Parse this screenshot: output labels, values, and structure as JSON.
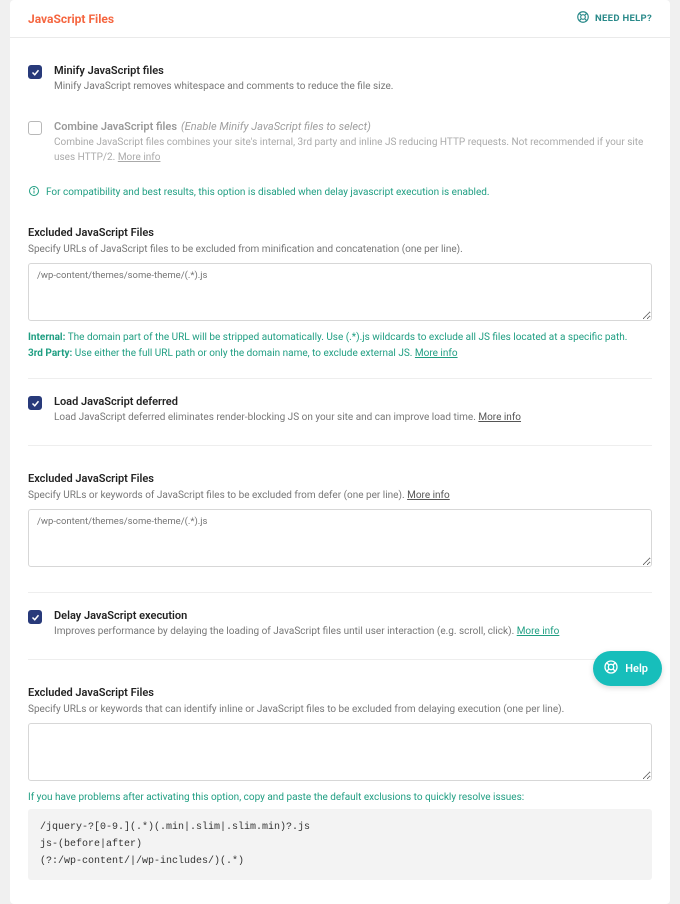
{
  "header": {
    "title": "JavaScript Files",
    "needHelp": "NEED HELP?"
  },
  "minify": {
    "label": "Minify JavaScript files",
    "desc": "Minify JavaScript removes whitespace and comments to reduce the file size.",
    "checked": true
  },
  "combine": {
    "label": "Combine JavaScript files",
    "suffix": "(Enable Minify JavaScript files to select)",
    "desc": "Combine JavaScript files combines your site's internal, 3rd party and inline JS reducing HTTP requests. Not recommended if your site uses HTTP/2.",
    "moreInfo": "More info",
    "note": "For compatibility and best results, this option is disabled when delay javascript execution is enabled.",
    "checked": false
  },
  "excludeMinify": {
    "label": "Excluded JavaScript Files",
    "desc": "Specify URLs of JavaScript files to be excluded from minification and concatenation (one per line).",
    "placeholder": "/wp-content/themes/some-theme/(.*).js",
    "value": "",
    "hintInternalLabel": "Internal:",
    "hintInternal": "The domain part of the URL will be stripped automatically. Use (.*).js wildcards to exclude all JS files located at a specific path.",
    "hint3rdLabel": "3rd Party:",
    "hint3rd": "Use either the full URL path or only the domain name, to exclude external JS.",
    "moreInfo": "More info"
  },
  "defer": {
    "label": "Load JavaScript deferred",
    "desc": "Load JavaScript deferred eliminates render-blocking JS on your site and can improve load time.",
    "moreInfo": "More info",
    "checked": true
  },
  "excludeDefer": {
    "label": "Excluded JavaScript Files",
    "desc": "Specify URLs or keywords of JavaScript files to be excluded from defer (one per line).",
    "moreInfo": "More info",
    "placeholder": "/wp-content/themes/some-theme/(.*).js",
    "value": ""
  },
  "delay": {
    "label": "Delay JavaScript execution",
    "desc": "Improves performance by delaying the loading of JavaScript files until user interaction (e.g. scroll, click).",
    "moreInfo": "More info",
    "checked": true
  },
  "excludeDelay": {
    "label": "Excluded JavaScript Files",
    "desc": "Specify URLs or keywords that can identify inline or JavaScript files to be excluded from delaying execution (one per line).",
    "value": "",
    "resolveNote": "If you have problems after activating this option, copy and paste the default exclusions to quickly resolve issues:",
    "code": "/jquery-?[0-9.](.*)(.min|.slim|.slim.min)?.js\njs-(before|after)\n(?:/wp-content/|/wp-includes/)(.*)"
  },
  "helpBubble": "Help"
}
